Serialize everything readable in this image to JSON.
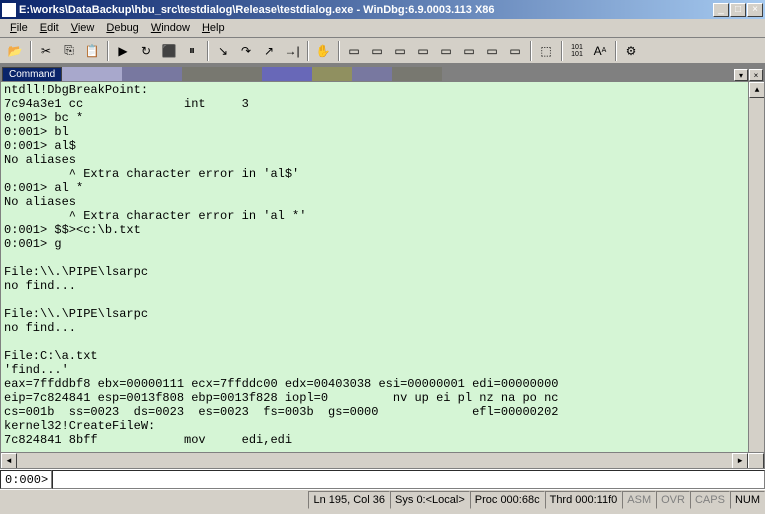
{
  "titlebar": {
    "text": "E:\\works\\DataBackup\\hbu_src\\testdialog\\Release\\testdialog.exe - WinDbg:6.9.0003.113 X86"
  },
  "menubar": {
    "items": [
      {
        "label": "File",
        "key": "F"
      },
      {
        "label": "Edit",
        "key": "E"
      },
      {
        "label": "View",
        "key": "V"
      },
      {
        "label": "Debug",
        "key": "D"
      },
      {
        "label": "Window",
        "key": "W"
      },
      {
        "label": "Help",
        "key": "H"
      }
    ]
  },
  "command_tab": {
    "label": "Command"
  },
  "console": {
    "lines": [
      "ntdll!DbgBreakPoint:",
      "7c94a3e1 cc              int     3",
      "0:001> bc *",
      "0:001> bl",
      "0:001> al$",
      "No aliases",
      "         ^ Extra character error in 'al$'",
      "0:001> al *",
      "No aliases",
      "         ^ Extra character error in 'al *'",
      "0:001> $$><c:\\b.txt",
      "0:001> g",
      "",
      "File:\\\\.\\PIPE\\lsarpc",
      "no find...",
      "",
      "File:\\\\.\\PIPE\\lsarpc",
      "no find...",
      "",
      "File:C:\\a.txt",
      "'find...'",
      "eax=7ffddbf8 ebx=00000111 ecx=7ffddc00 edx=00403038 esi=00000001 edi=00000000",
      "eip=7c824841 esp=0013f808 ebp=0013f828 iopl=0         nv up ei pl nz na po nc",
      "cs=001b  ss=0023  ds=0023  es=0023  fs=003b  gs=0000             efl=00000202",
      "kernel32!CreateFileW:",
      "7c824841 8bff            mov     edi,edi"
    ]
  },
  "input": {
    "prompt": "0:000>",
    "value": ""
  },
  "statusbar": {
    "ln_col": "Ln 195, Col 36",
    "sys": "Sys 0:<Local>",
    "proc": "Proc 000:68c",
    "thrd": "Thrd 000:11f0",
    "asm": "ASM",
    "ovr": "OVR",
    "caps": "CAPS",
    "num": "NUM"
  }
}
